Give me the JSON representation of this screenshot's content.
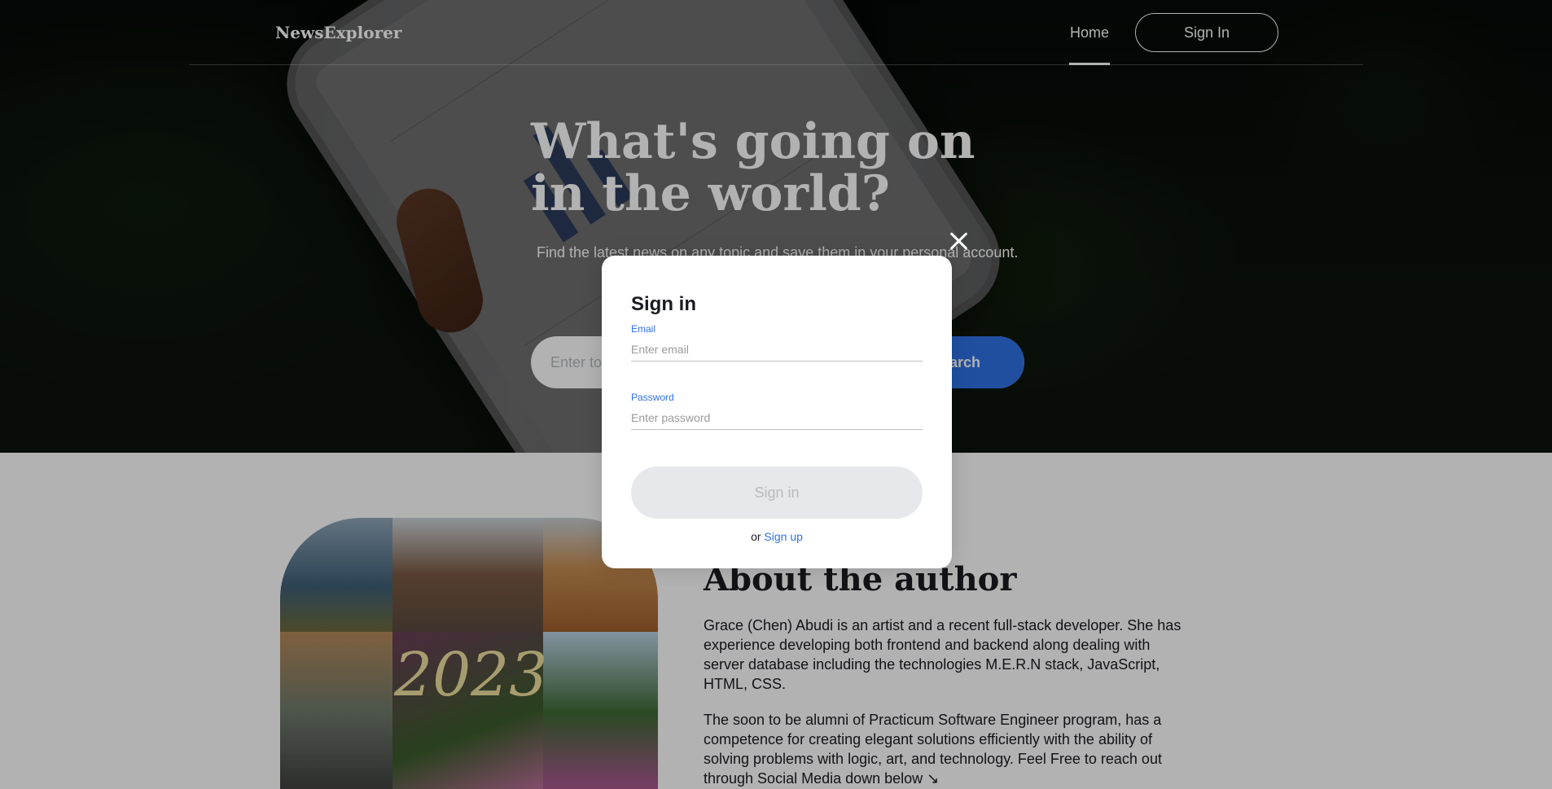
{
  "header": {
    "logo": "NewsExplorer",
    "nav_home": "Home",
    "nav_signin": "Sign In"
  },
  "hero": {
    "title": "What's going on in the world?",
    "subtitle": "Find the latest news on any topic and save them in your personal account.",
    "search_placeholder": "Enter topic",
    "search_button": "Search"
  },
  "about": {
    "title": "About the author",
    "paragraph_1": "Grace (Chen) Abudi is an artist and a recent full-stack developer. She has experience developing both frontend and backend along dealing with server database including the technologies M.E.R.N stack, JavaScript, HTML, CSS.",
    "paragraph_2": "The soon to be alumni of Practicum Software Engineer program, has a competence for creating elegant solutions efficiently with the ability of solving problems with logic, art, and technology. Feel Free to reach out through Social Media down below ↘",
    "collage_text": "2023"
  },
  "modal": {
    "title": "Sign in",
    "email_label": "Email",
    "email_placeholder": "Enter email",
    "password_label": "Password",
    "password_placeholder": "Enter password",
    "submit": "Sign in",
    "alt_prefix": "or ",
    "alt_link": "Sign up"
  },
  "colors": {
    "accent": "#2f71e5",
    "text_dark": "#1a1b22",
    "button_disabled_bg": "#e6e8eb",
    "button_disabled_text": "#b6bcbf"
  },
  "icons": {
    "close": "close-icon"
  }
}
